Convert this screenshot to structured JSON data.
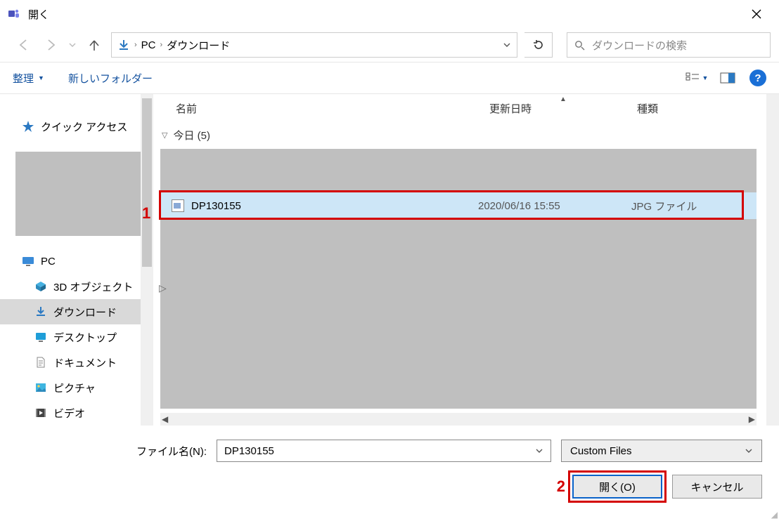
{
  "title": "開く",
  "breadcrumbs": {
    "root": "PC",
    "current": "ダウンロード"
  },
  "search": {
    "placeholder": "ダウンロードの検索"
  },
  "toolbar": {
    "organize": "整理",
    "new_folder": "新しいフォルダー"
  },
  "columns": {
    "name": "名前",
    "date": "更新日時",
    "type": "種類"
  },
  "group": {
    "label": "今日 (5)"
  },
  "file": {
    "name": "DP130155",
    "date": "2020/06/16 15:55",
    "type": "JPG ファイル"
  },
  "sidebar": {
    "quick": "クイック アクセス",
    "pc": "PC",
    "items": [
      {
        "label": "3D オブジェクト"
      },
      {
        "label": "ダウンロード"
      },
      {
        "label": "デスクトップ"
      },
      {
        "label": "ドキュメント"
      },
      {
        "label": "ピクチャ"
      },
      {
        "label": "ビデオ"
      }
    ]
  },
  "footer": {
    "filename_label": "ファイル名(N):",
    "filename_value": "DP130155",
    "filetype": "Custom Files",
    "open": "開く(O)",
    "cancel": "キャンセル"
  },
  "annotations": {
    "one": "1",
    "two": "2"
  }
}
